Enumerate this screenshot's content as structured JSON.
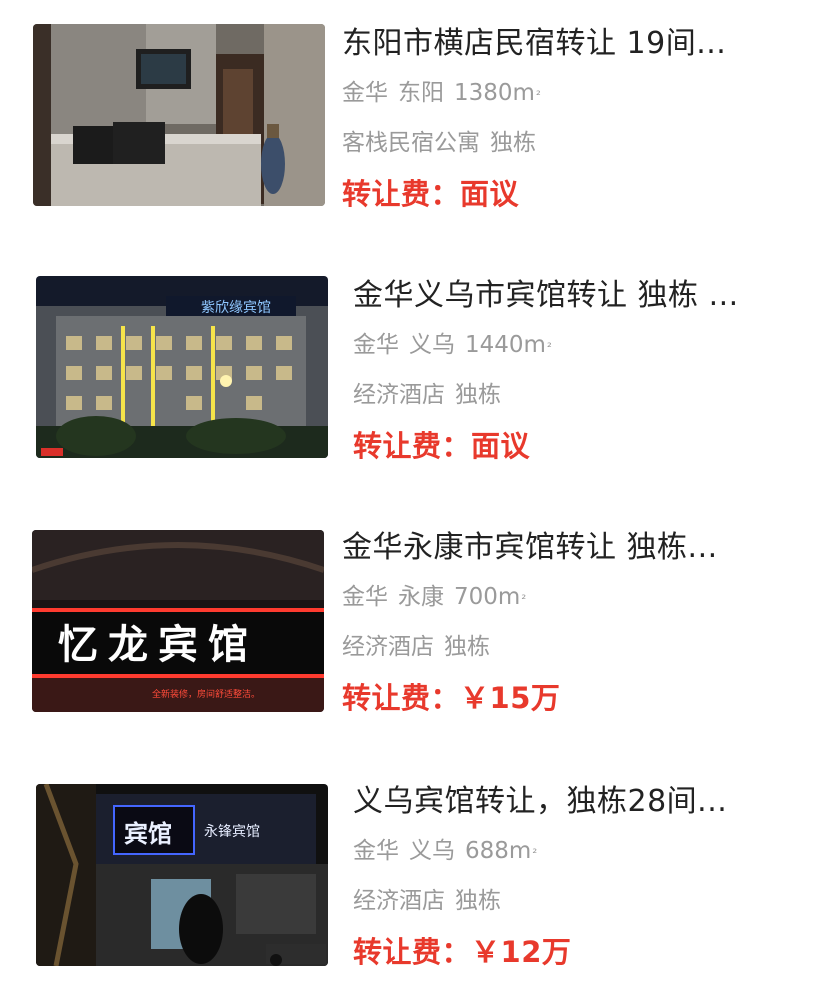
{
  "listings": [
    {
      "title": "东阳市横店民宿转让 19间...",
      "city": "金华",
      "district": "东阳",
      "area_value": "1380m",
      "area_unit": "²",
      "category": "客栈民宿公寓",
      "building": "独栋",
      "fee_label": "转让费：",
      "fee_value": "面议",
      "image": "hostel-lobby-photo"
    },
    {
      "title": "金华义乌市宾馆转让 独栋 ...",
      "city": "金华",
      "district": "义乌",
      "area_value": "1440m",
      "area_unit": "²",
      "category": "经济酒店",
      "building": "独栋",
      "fee_label": "转让费：",
      "fee_value": "面议",
      "image": "hotel-night-facade-photo",
      "sign_text": "紫欣缘宾馆"
    },
    {
      "title": "金华永康市宾馆转让 独栋...",
      "city": "金华",
      "district": "永康",
      "area_value": "700m",
      "area_unit": "²",
      "category": "经济酒店",
      "building": "独栋",
      "fee_label": "转让费：",
      "fee_value": "￥15万",
      "image": "hotel-signboard-photo",
      "sign_text": "忆龙宾馆",
      "sign_subtext": "全新装修，房间舒适整洁。"
    },
    {
      "title": "义乌宾馆转让，独栋28间...",
      "city": "金华",
      "district": "义乌",
      "area_value": "688m",
      "area_unit": "²",
      "category": "经济酒店",
      "building": "独栋",
      "fee_label": "转让费：",
      "fee_value": "￥12万",
      "image": "hotel-entrance-night-photo",
      "sign_text": "宾馆",
      "sign_text_2": "永锋宾馆"
    }
  ],
  "colors": {
    "fee": "#e8392c",
    "meta": "#9a9a9a",
    "title": "#222222"
  }
}
